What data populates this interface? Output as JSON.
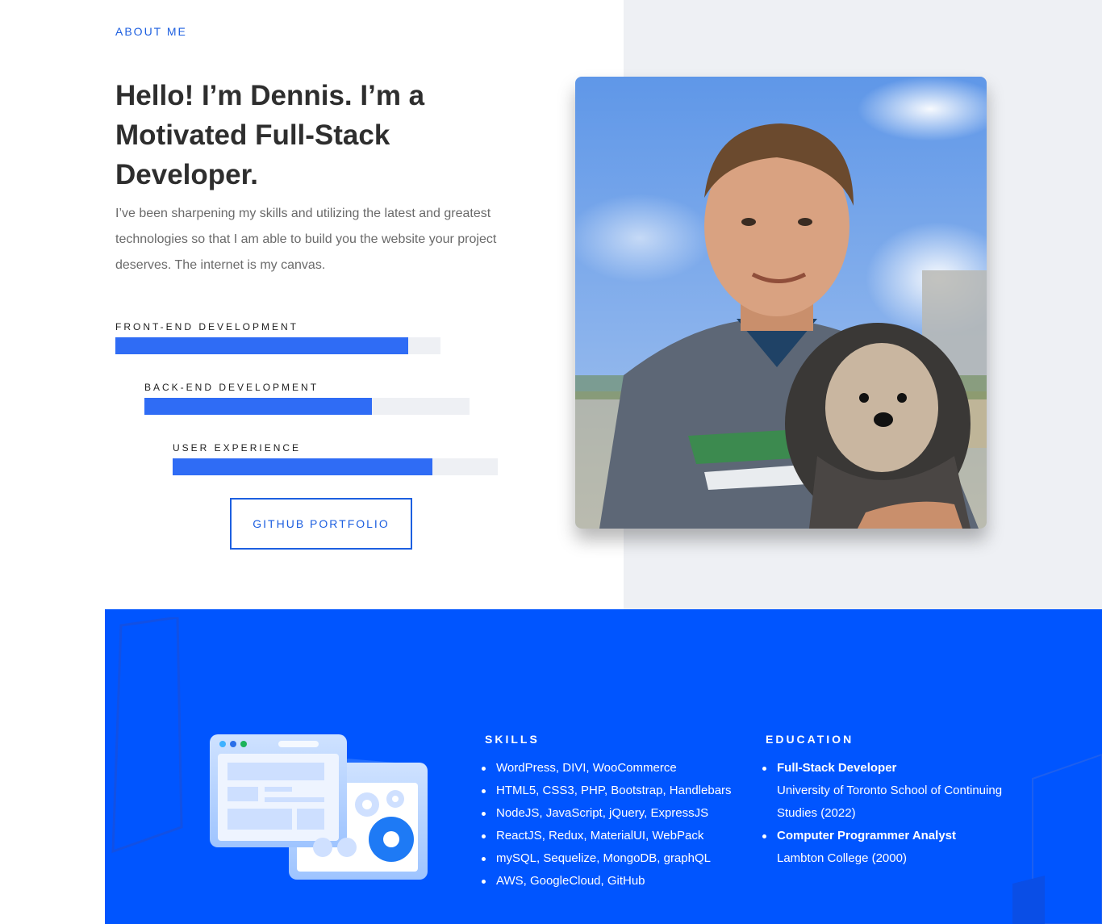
{
  "about": {
    "eyebrow": "ABOUT ME",
    "headline": "Hello! I’m Dennis. I’m a Motivated Full-Stack Developer.",
    "intro": "I’ve been sharpening my skills and utilizing the latest and greatest technologies so that I am able to build you the website your project deserves. The internet is my canvas.",
    "skills": [
      {
        "label": "FRONT-END DEVELOPMENT",
        "percent": 90
      },
      {
        "label": "BACK-END DEVELOPMENT",
        "percent": 70
      },
      {
        "label": "USER EXPERIENCE",
        "percent": 80
      }
    ],
    "github_button": "GITHUB PORTFOLIO"
  },
  "skills_section": {
    "title": "SKILLS",
    "items": [
      "WordPress, DIVI, WooCommerce",
      "HTML5, CSS3, PHP, Bootstrap, Handlebars",
      "NodeJS, JavaScript, jQuery, ExpressJS",
      "ReactJS, Redux, MaterialUI, WebPack",
      "mySQL, Sequelize, MongoDB, graphQL",
      "AWS, GoogleCloud, GitHub"
    ]
  },
  "education_section": {
    "title": "EDUCATION",
    "items": [
      {
        "degree": "Full-Stack Developer",
        "school": "University of Toronto School of Continuing Studies (2022)"
      },
      {
        "degree": "Computer Programmer Analyst",
        "school": "Lambton College (2000)"
      }
    ]
  },
  "colors": {
    "accent": "#1d5fe0",
    "bar": "#2f6cf5",
    "blue_section": "#0055ff",
    "panel_bg": "#eef0f4"
  }
}
